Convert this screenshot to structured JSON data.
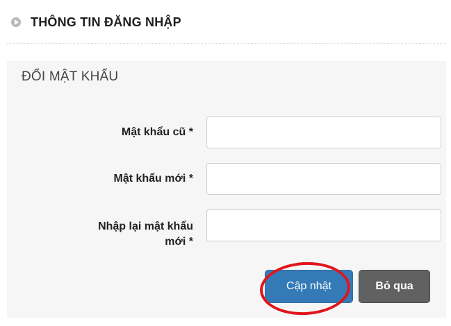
{
  "header": {
    "title": "THÔNG TIN ĐĂNG NHẬP",
    "icon": "circle-play-icon"
  },
  "panel": {
    "section_title": "ĐỔI MẬT KHẨU",
    "fields": [
      {
        "label": "Mật khẩu cũ *",
        "value": "",
        "placeholder": ""
      },
      {
        "label": "Mật khẩu mới *",
        "value": "",
        "placeholder": ""
      },
      {
        "label_line_1": "Nhập lại mật khẩu",
        "label_line_2": "mới *",
        "value": "",
        "placeholder": ""
      }
    ],
    "buttons": {
      "update": "Cập nhật",
      "skip": "Bỏ qua"
    }
  },
  "colors": {
    "primary_button": "#337ab7",
    "secondary_button": "#616161",
    "annotation_ring": "#e1151b",
    "panel_background": "#f6f6f6"
  }
}
